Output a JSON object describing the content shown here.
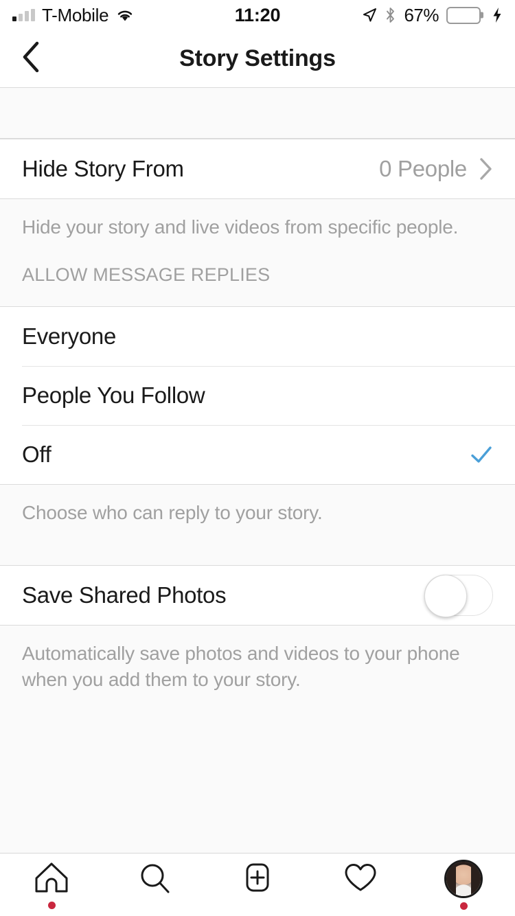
{
  "status_bar": {
    "carrier": "T-Mobile",
    "time": "11:20",
    "battery_percent": "67%",
    "signal_bars_filled": 1,
    "signal_bars_total": 4,
    "wifi_icon": "wifi-icon",
    "location_icon": "location-arrow-icon",
    "bluetooth_icon": "bluetooth-icon",
    "battery_icon": "battery-icon",
    "charging_icon": "charging-bolt-icon",
    "battery_fill_color": "#4cd964"
  },
  "header": {
    "title": "Story Settings",
    "back_icon": "chevron-left-icon"
  },
  "hide_story": {
    "label": "Hide Story From",
    "value": "0 People",
    "chevron_icon": "chevron-right-icon",
    "footnote": "Hide your story and live videos from specific people."
  },
  "allow_message_replies": {
    "section_title": "ALLOW MESSAGE REPLIES",
    "options": [
      {
        "label": "Everyone",
        "selected": false
      },
      {
        "label": "People You Follow",
        "selected": false
      },
      {
        "label": "Off",
        "selected": true
      }
    ],
    "selected_check_icon": "checkmark-icon",
    "check_color": "#4a9fd8",
    "footnote": "Choose who can reply to your story."
  },
  "save_shared_photos": {
    "label": "Save Shared Photos",
    "toggle_state": "off",
    "footnote": "Automatically save photos and videos to your phone when you add them to your story."
  },
  "tab_bar": {
    "tabs": [
      {
        "name": "home",
        "icon": "home-icon",
        "badge": true
      },
      {
        "name": "search",
        "icon": "search-icon",
        "badge": false
      },
      {
        "name": "add",
        "icon": "plus-square-icon",
        "badge": false
      },
      {
        "name": "activity",
        "icon": "heart-icon",
        "badge": false
      },
      {
        "name": "profile",
        "icon": "profile-avatar-icon",
        "badge": true
      }
    ],
    "badge_color": "#c9273e"
  }
}
